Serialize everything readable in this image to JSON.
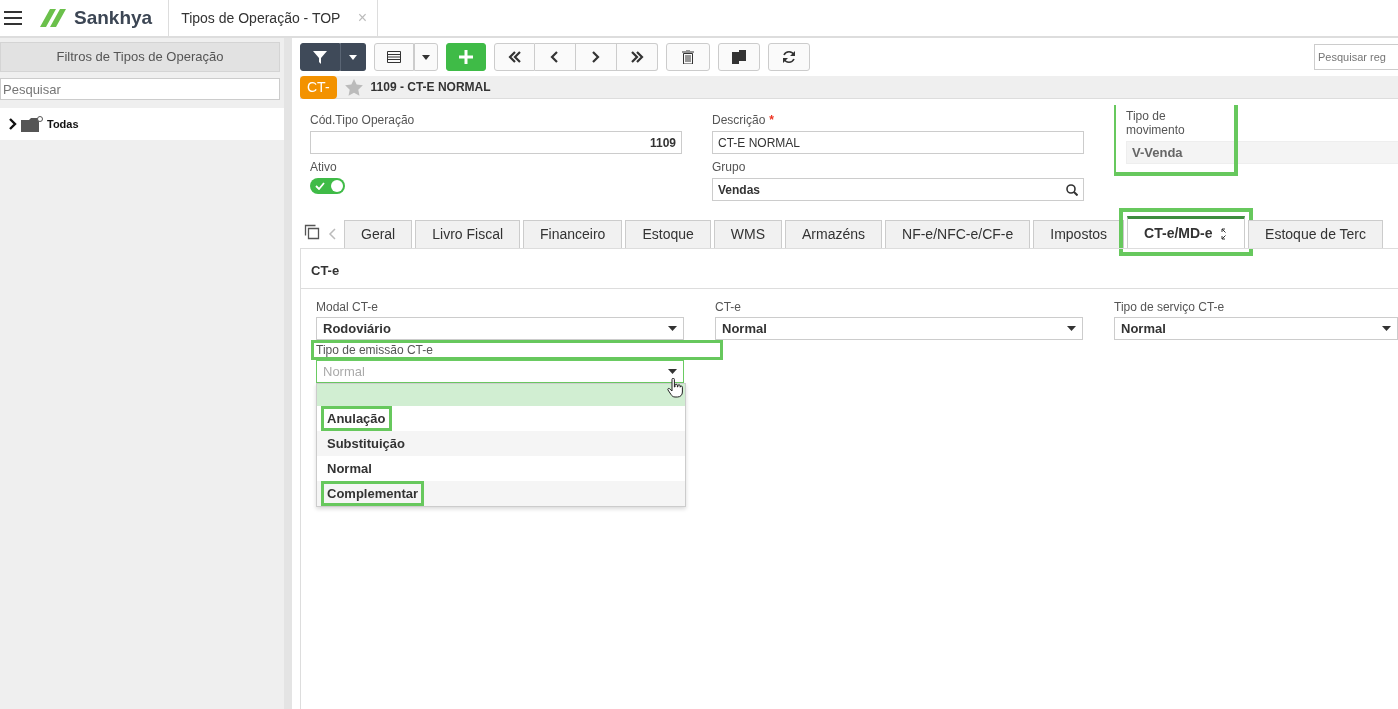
{
  "app": {
    "logo": "Sankhya",
    "tab_title": "Tipos de Operação - TOP",
    "tab_close": "×"
  },
  "sidebar": {
    "title": "Filtros de Tipos de Operação",
    "search": {
      "placeholder": "Pesquisar"
    },
    "tree": [
      {
        "label": "Todas",
        "expanded": false
      }
    ]
  },
  "toolbar": {
    "search": {
      "placeholder": "Pesquisar reg"
    }
  },
  "record": {
    "badge": "CT-",
    "favorite": false,
    "title": "1109 - CT-E NORMAL"
  },
  "form_columns": [
    [
      {
        "kind": "number",
        "label": "Cód.Tipo Operação",
        "value": "1109"
      },
      {
        "kind": "switch",
        "label": "Ativo",
        "on": true
      }
    ],
    [
      {
        "kind": "text",
        "label": "Descrição",
        "required_mark": "*",
        "value": "CT-E NORMAL"
      },
      {
        "kind": "lookup",
        "label": "Grupo",
        "value": "Vendas"
      }
    ],
    [
      {
        "kind": "readonly",
        "label": "Tipo de movimento",
        "value": "V-Venda",
        "highlighted": true
      }
    ]
  ],
  "tabs": [
    {
      "label": "Geral",
      "selected": false,
      "highlighted": false
    },
    {
      "label": "Livro Fiscal",
      "selected": false,
      "highlighted": false
    },
    {
      "label": "Financeiro",
      "selected": false,
      "highlighted": false
    },
    {
      "label": "Estoque",
      "selected": false,
      "highlighted": false
    },
    {
      "label": "WMS",
      "selected": false,
      "highlighted": false
    },
    {
      "label": "Armazéns",
      "selected": false,
      "highlighted": false
    },
    {
      "label": "NF-e/NFC-e/CF-e",
      "selected": false,
      "highlighted": false
    },
    {
      "label": "Impostos",
      "selected": false,
      "highlighted": false
    },
    {
      "label": "CT-e/MD-e",
      "selected": true,
      "highlighted": true
    },
    {
      "label": "Estoque de Terc",
      "selected": false,
      "highlighted": false
    }
  ],
  "section": {
    "title": "CT-e",
    "fields": [
      {
        "label": "Modal CT-e",
        "value": "Rodoviário",
        "open": false,
        "highlighted": false
      },
      {
        "label": "CT-e",
        "value": "Normal",
        "open": false,
        "highlighted": false
      },
      {
        "label": "Tipo de serviço CT-e",
        "value": "Normal",
        "open": false,
        "highlighted": false
      },
      {
        "label": "Tipo de emissão CT-e",
        "value": "Normal",
        "open": true,
        "highlighted": true
      }
    ]
  },
  "dropdown": {
    "options": [
      {
        "label": "Anulação",
        "highlighted": true
      },
      {
        "label": "Substituição",
        "highlighted": false
      },
      {
        "label": "Normal",
        "highlighted": false
      },
      {
        "label": "Complementar",
        "highlighted": true
      }
    ]
  }
}
